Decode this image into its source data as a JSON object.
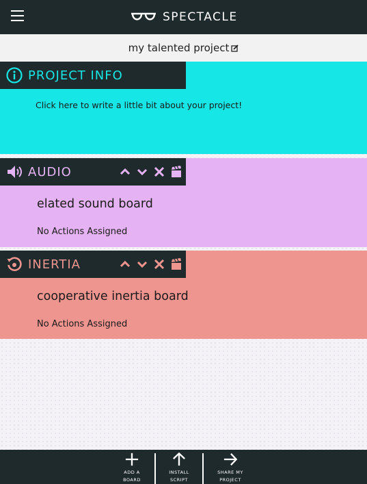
{
  "app": {
    "title": "SPECTACLE"
  },
  "project": {
    "name": "my talented project"
  },
  "info_panel": {
    "title": "PROJECT INFO",
    "placeholder_text": "Click here to write a little bit about your project!"
  },
  "boards": [
    {
      "type_title": "AUDIO",
      "name": "elated sound board",
      "actions_text": "No Actions Assigned"
    },
    {
      "type_title": "INERTIA",
      "name": "cooperative inertia board",
      "actions_text": "No Actions Assigned"
    }
  ],
  "bottom_bar": {
    "add_board_label": "ADD A BOARD",
    "install_script_label": "INSTALL SCRIPT",
    "share_project_label": "SHARE MY PROJECT"
  },
  "colors": {
    "dark": "#1f2a2c",
    "info_cyan": "#17e6e6",
    "audio_purple": "#e5b3f3",
    "inertia_salmon": "#ef9590"
  }
}
